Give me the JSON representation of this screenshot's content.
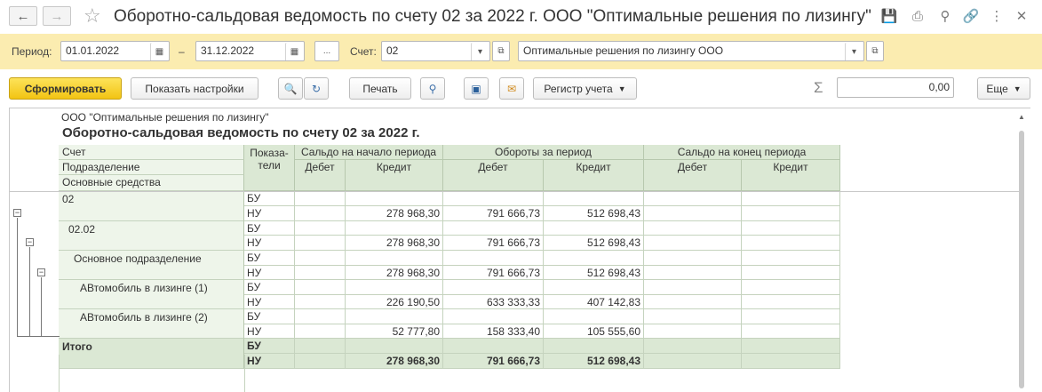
{
  "window": {
    "title": "Оборотно-сальдовая ведомость по счету 02 за 2022 г. ООО \"Оптимальные решения по лизингу\""
  },
  "params": {
    "period_label": "Период:",
    "date_from": "01.01.2022",
    "dash": "–",
    "date_to": "31.12.2022",
    "more_label": "...",
    "account_label": "Счет:",
    "account_value": "02",
    "organization_value": "Оптимальные решения по лизингу ООО"
  },
  "toolbar": {
    "generate_label": "Сформировать",
    "settings_label": "Показать настройки",
    "print_label": "Печать",
    "register_label": "Регистр учета",
    "sum_value": "0,00",
    "more_label": "Еще"
  },
  "report": {
    "org_line": "ООО \"Оптимальные решения по лизингу\"",
    "title": "Оборотно-сальдовая ведомость по счету 02 за 2022 г.",
    "header": {
      "account": "Счет",
      "division": "Подразделение",
      "assets": "Основные средства",
      "indicators_1": "Показа-",
      "indicators_2": "тели",
      "opening": "Сальдо на начало периода",
      "turnover": "Обороты за период",
      "closing": "Сальдо на конец периода",
      "debit": "Дебет",
      "credit": "Кредит"
    },
    "rows": [
      {
        "label": "02",
        "indicator": "БУ",
        "values": [
          "",
          "",
          "",
          "",
          "",
          ""
        ]
      },
      {
        "label": "",
        "indicator": "НУ",
        "values": [
          "",
          "278 968,30",
          "791 666,73",
          "512 698,43",
          "",
          ""
        ]
      },
      {
        "label": "02.02",
        "indicator": "БУ",
        "values": [
          "",
          "",
          "",
          "",
          "",
          ""
        ]
      },
      {
        "label": "",
        "indicator": "НУ",
        "values": [
          "",
          "278 968,30",
          "791 666,73",
          "512 698,43",
          "",
          ""
        ]
      },
      {
        "label": "Основное подразделение",
        "indicator": "БУ",
        "values": [
          "",
          "",
          "",
          "",
          "",
          ""
        ]
      },
      {
        "label": "",
        "indicator": "НУ",
        "values": [
          "",
          "278 968,30",
          "791 666,73",
          "512 698,43",
          "",
          ""
        ]
      },
      {
        "label": "АВтомобиль в лизинге (1)",
        "indicator": "БУ",
        "values": [
          "",
          "",
          "",
          "",
          "",
          ""
        ]
      },
      {
        "label": "",
        "indicator": "НУ",
        "values": [
          "",
          "226 190,50",
          "633 333,33",
          "407 142,83",
          "",
          ""
        ]
      },
      {
        "label": "АВтомобиль в лизинге (2)",
        "indicator": "БУ",
        "values": [
          "",
          "",
          "",
          "",
          "",
          ""
        ]
      },
      {
        "label": "",
        "indicator": "НУ",
        "values": [
          "",
          "52 777,80",
          "158 333,40",
          "105 555,60",
          "",
          ""
        ]
      },
      {
        "label": "Итого",
        "indicator": "БУ",
        "values": [
          "",
          "",
          "",
          "",
          "",
          ""
        ]
      },
      {
        "label": "",
        "indicator": "НУ",
        "values": [
          "",
          "278 968,30",
          "791 666,73",
          "512 698,43",
          "",
          ""
        ]
      }
    ]
  }
}
